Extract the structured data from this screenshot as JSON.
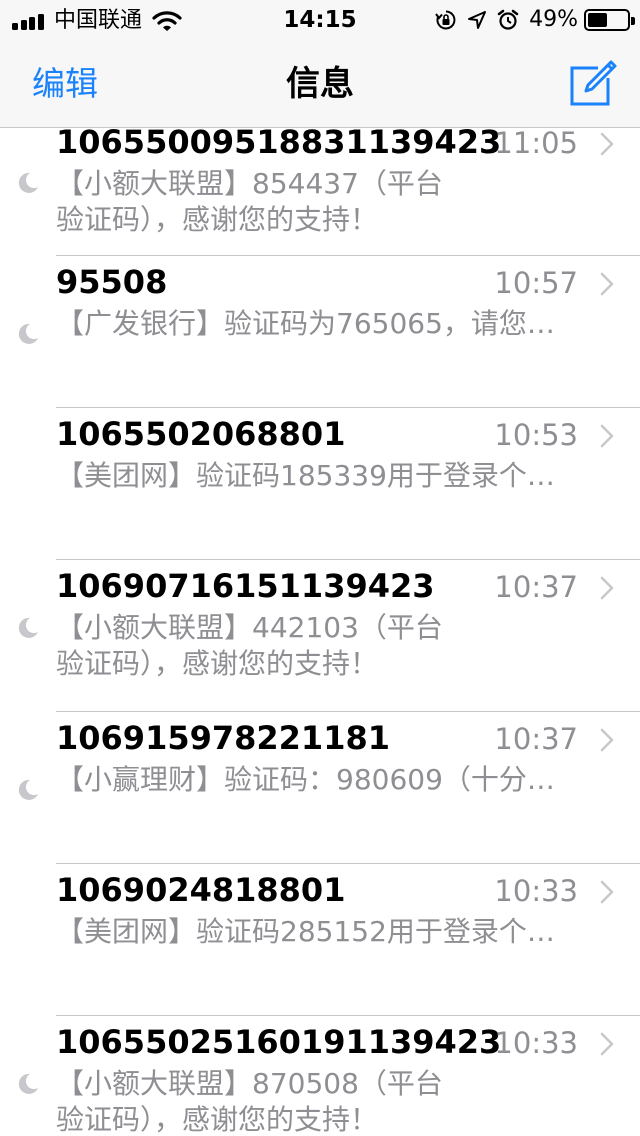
{
  "status_bar": {
    "carrier": "中国联通",
    "time": "14:15",
    "battery_percent": "49%",
    "battery_level": 0.49,
    "icons": [
      "signal-icon",
      "wifi-icon",
      "orientation-lock-icon",
      "location-icon",
      "alarm-icon",
      "battery-icon"
    ]
  },
  "nav": {
    "edit_label": "编辑",
    "title": "信息",
    "compose_icon": "compose-icon"
  },
  "colors": {
    "accent": "#1a82fb",
    "secondary_text": "#8e8e93",
    "separator": "#c8c7cc",
    "bar_background": "#f7f7f7"
  },
  "messages": [
    {
      "sender": "106550095188311394 23",
      "time": "11:05",
      "muted": true,
      "preview_lines": [
        "【小额大联盟】854437（平台",
        "验证码），感谢您的支持！"
      ]
    },
    {
      "sender": "95508",
      "time": "10:57",
      "muted": true,
      "preview_lines": [
        "【广发银行】验证码为765065，请您…"
      ]
    },
    {
      "sender": "1065502068801",
      "time": "10:53",
      "muted": false,
      "preview_lines": [
        "【美团网】验证码185339用于登录个…"
      ]
    },
    {
      "sender": "10690716151139423",
      "time": "10:37",
      "muted": true,
      "preview_lines": [
        "【小额大联盟】442103（平台",
        "验证码），感谢您的支持！"
      ]
    },
    {
      "sender": "106915978221181",
      "time": "10:37",
      "muted": true,
      "preview_lines": [
        "【小赢理财】验证码：980609（十分…"
      ]
    },
    {
      "sender": "1069024818801",
      "time": "10:33",
      "muted": false,
      "preview_lines": [
        "【美团网】验证码285152用于登录个…"
      ]
    },
    {
      "sender": "10655025160191139423",
      "time": "10:33",
      "muted": true,
      "preview_lines": [
        "【小额大联盟】870508（平台",
        "验证码），感谢您的支持！"
      ]
    }
  ]
}
